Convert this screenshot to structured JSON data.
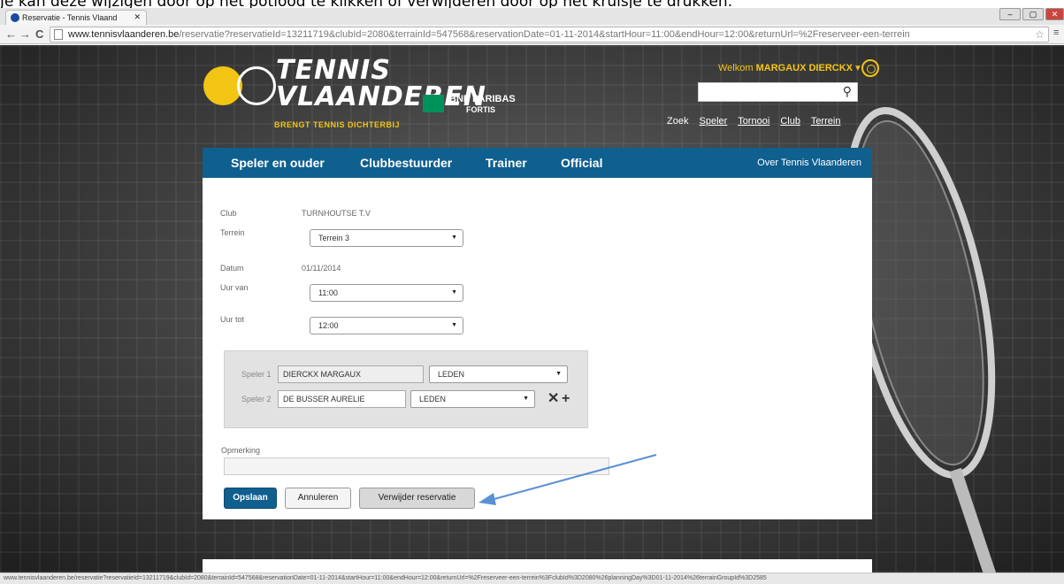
{
  "caption": "Je kan deze wijzigen door op het potlood te klikken of verwijderen door op het kruisje te drukken.",
  "browser": {
    "tab_title": "Reservatie - Tennis Vlaand",
    "url_host": "www.tennisvlaanderen.be",
    "url_path": "/reservatie?reservatieId=13211719&clubId=2080&terrainId=547568&reservationDate=01-11-2014&startHour=11:00&endHour=12:00&returnUrl=%2Freserveer-een-terrein",
    "status_text": "www.tennisvlaanderen.be/reservatie?reservatieId=13211719&clubId=2080&terrainId=547568&reservationDate=01-11-2014&startHour=11:00&endHour=12:00&returnUrl=%2Freserveer-een-terrein%3FclubId%3D2080%26planningDay%3D01-11-2014%26terrainGroupId%3D2585"
  },
  "header": {
    "logo_line1": "TENNIS",
    "logo_line2": "VLAANDEREN",
    "logo_tagline": "BRENGT TENNIS DICHTERBIJ",
    "sponsor_line1": "BNP PARIBAS",
    "sponsor_line2": "FORTIS",
    "welcome_prefix": "Welkom",
    "welcome_name": "MARGAUX DIERCKX",
    "search_label": "Zoek",
    "links": [
      "Speler",
      "Tornooi",
      "Club",
      "Terrein"
    ]
  },
  "nav": {
    "items": [
      "Speler en ouder",
      "Clubbestuurder",
      "Trainer",
      "Official"
    ],
    "right": "Over Tennis Vlaanderen"
  },
  "form": {
    "club_label": "Club",
    "club_value": "TURNHOUTSE T.V",
    "terrein_label": "Terrein",
    "terrein_value": "Terrein 3",
    "datum_label": "Datum",
    "datum_value": "01/11/2014",
    "uur_van_label": "Uur van",
    "uur_van_value": "11:00",
    "uur_tot_label": "Uur tot",
    "uur_tot_value": "12:00",
    "speler1_label": "Speler 1",
    "speler1_name": "DIERCKX MARGAUX",
    "speler1_type": "LEDEN",
    "speler2_label": "Speler 2",
    "speler2_name": "DE BUSSER AURELIE",
    "speler2_type": "LEDEN",
    "remark_label": "Opmerking",
    "remark_value": "",
    "save": "Opslaan",
    "cancel": "Annuleren",
    "delete": "Verwijder reservatie"
  },
  "colors": {
    "brand_blue": "#0f5f8f",
    "brand_yellow": "#f2c414",
    "annotation_arrow": "#5b8fd4"
  }
}
